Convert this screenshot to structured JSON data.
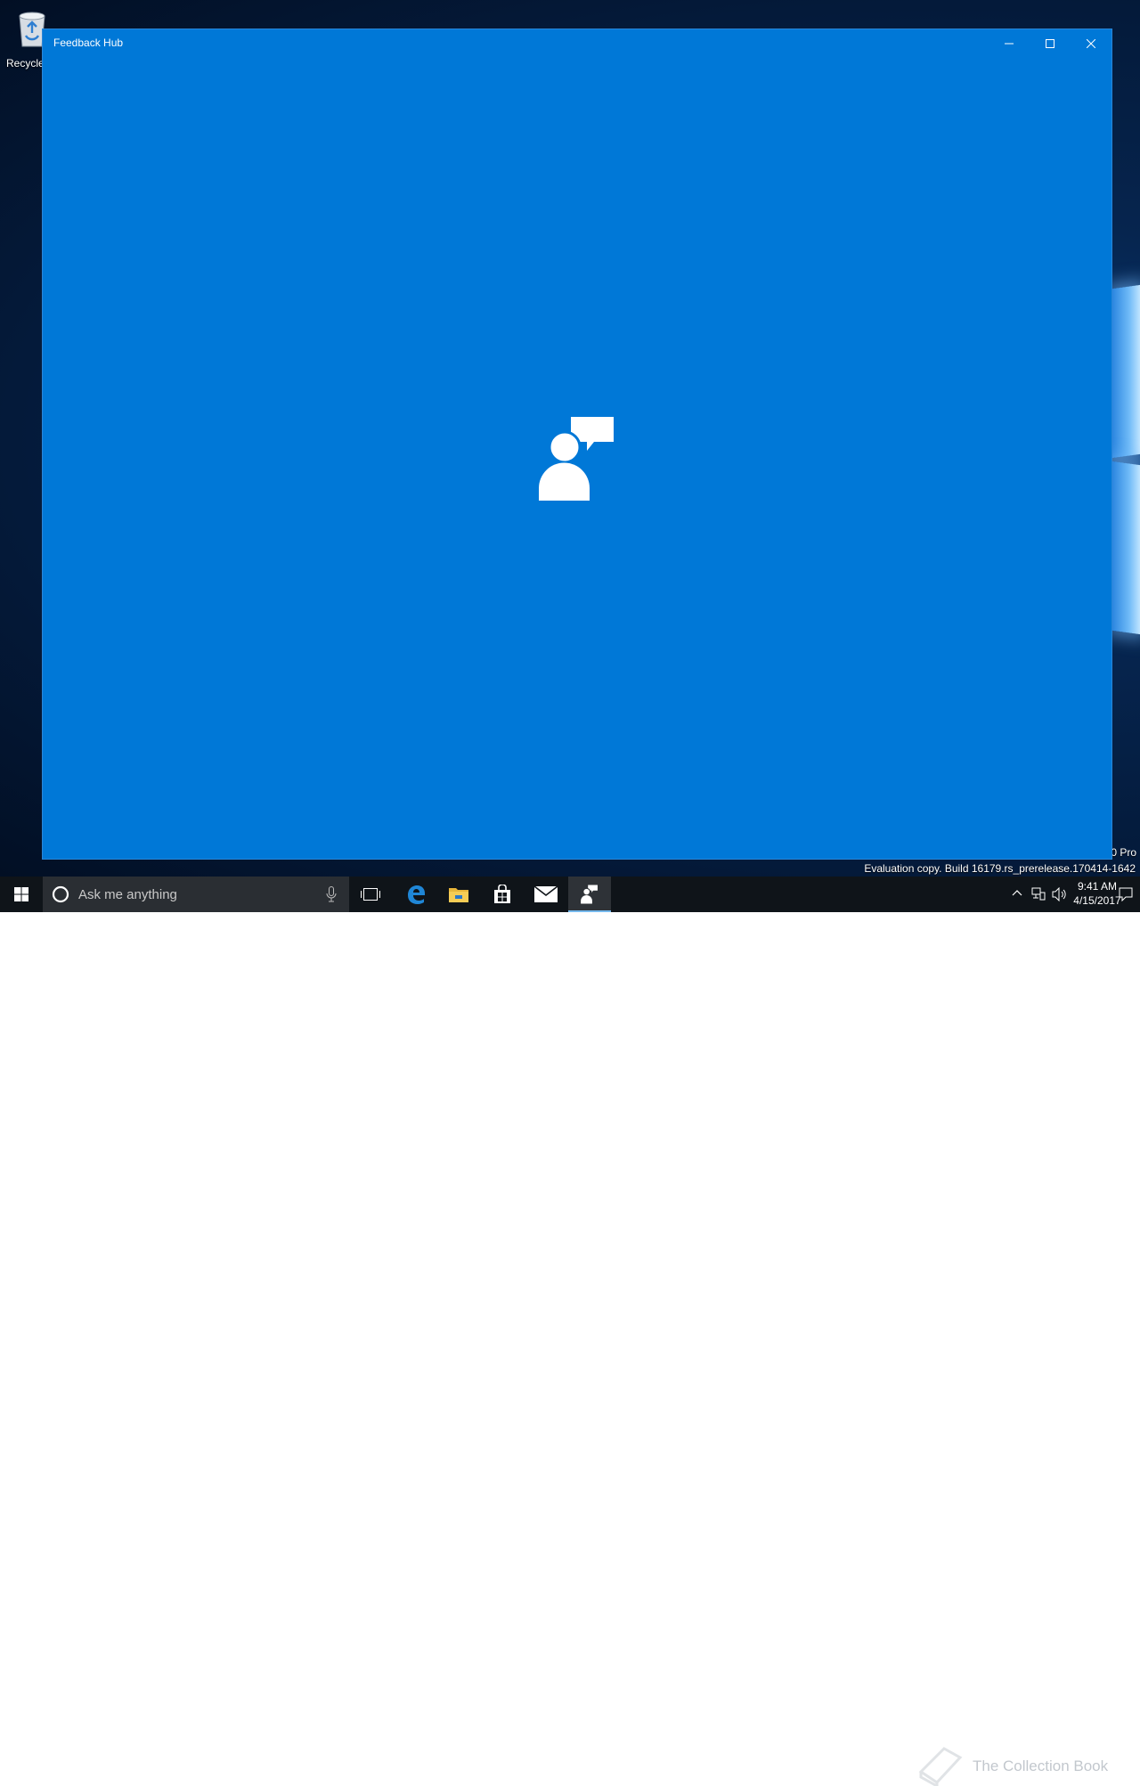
{
  "desktop": {
    "recycle_bin_label": "Recycle",
    "edition_text": "0 Pro",
    "build_text": "Evaluation copy. Build 16179.rs_prerelease.170414-1642"
  },
  "window": {
    "title": "Feedback Hub",
    "background_color": "#0078d7",
    "splash_icon": "feedback-person-icon",
    "caption_buttons": [
      "minimize-icon",
      "maximize-icon",
      "close-icon"
    ]
  },
  "taskbar": {
    "search_placeholder": "Ask me anything",
    "apps": [
      {
        "name": "task-view-icon"
      },
      {
        "name": "edge-icon"
      },
      {
        "name": "file-explorer-icon"
      },
      {
        "name": "store-icon"
      },
      {
        "name": "mail-icon"
      },
      {
        "name": "feedback-hub-icon",
        "active": true
      }
    ],
    "clock": {
      "time": "9:41 AM",
      "date": "4/15/2017"
    }
  },
  "watermark": {
    "text": "The Collection Book"
  }
}
